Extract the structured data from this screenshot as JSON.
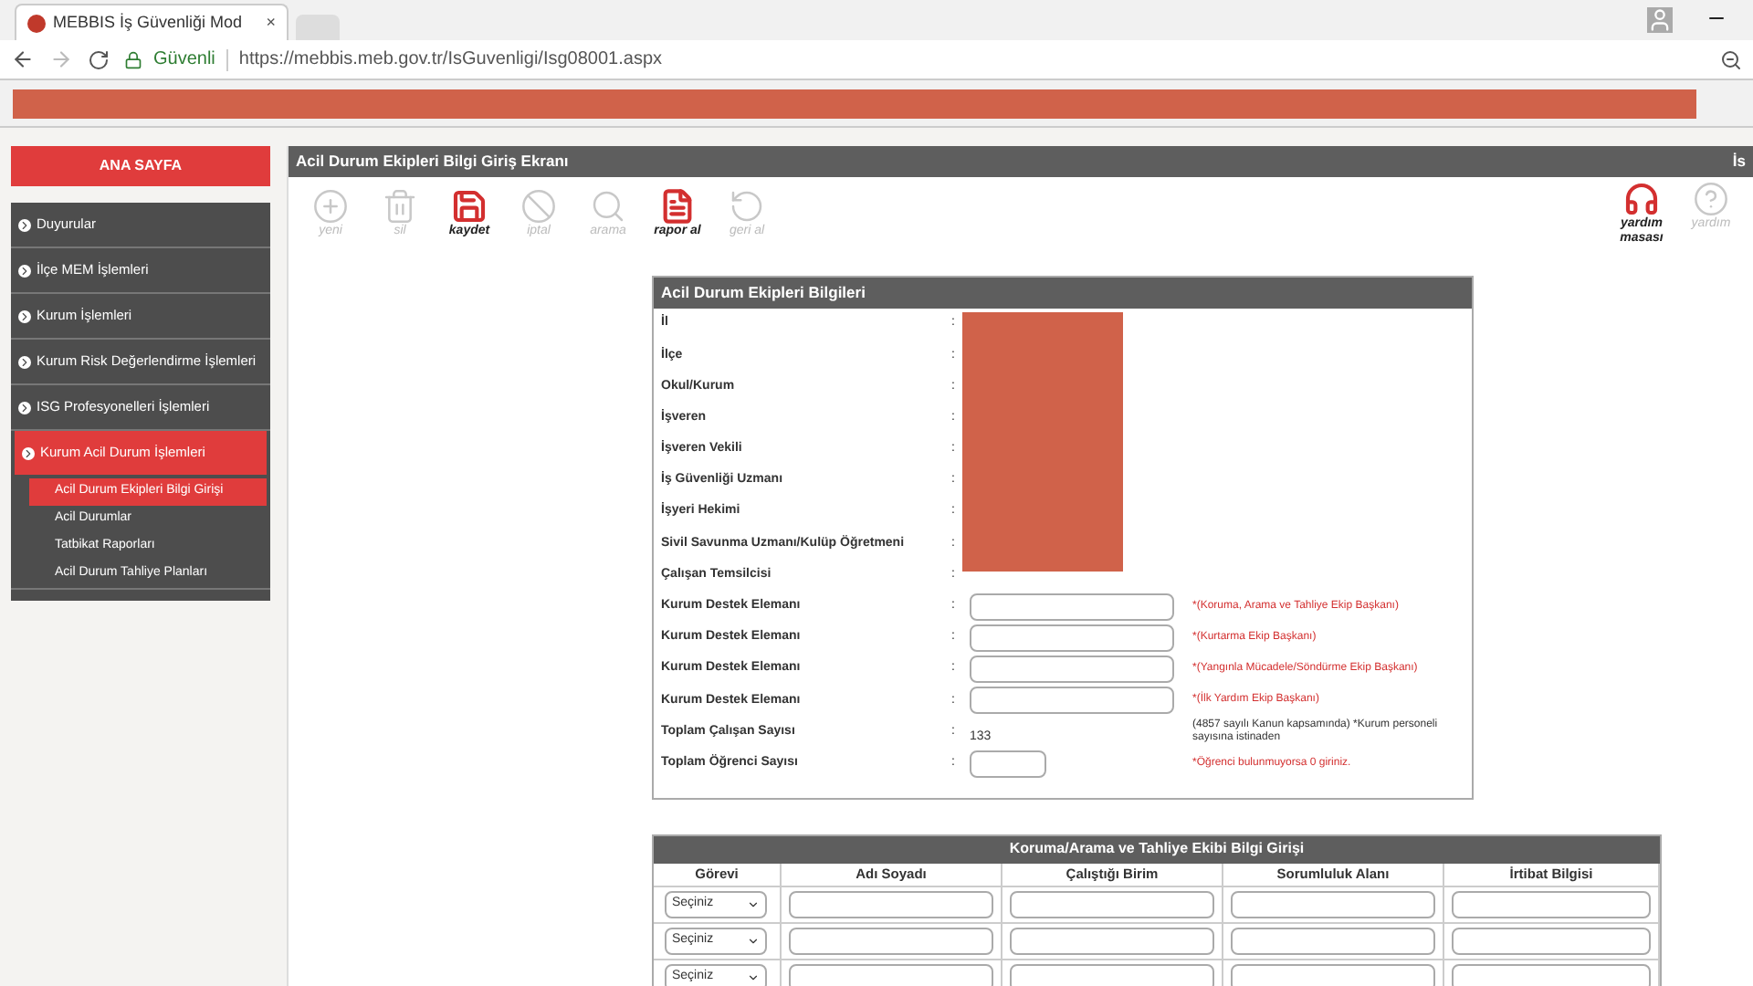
{
  "browser": {
    "tab_title": "MEBBIS İş Güvenliği Mod",
    "tab_close": "×",
    "secure_label": "Güvenli",
    "url": "https://mebbis.meb.gov.tr/IsGuvenligi/Isg08001.aspx"
  },
  "sidebar": {
    "home": "ANA SAYFA",
    "items": [
      {
        "label": "Duyurular",
        "selected": false
      },
      {
        "label": "İlçe MEM İşlemleri",
        "selected": false
      },
      {
        "label": "Kurum İşlemleri",
        "selected": false
      },
      {
        "label": "Kurum Risk Değerlendirme İşlemleri",
        "selected": false
      },
      {
        "label": "ISG Profesyonelleri İşlemleri",
        "selected": false
      },
      {
        "label": "Kurum Acil Durum İşlemleri",
        "selected": true,
        "children": [
          {
            "label": "Acil Durum Ekipleri Bilgi Girişi",
            "selected": true
          },
          {
            "label": "Acil Durumlar",
            "selected": false
          },
          {
            "label": "Tatbikat Raporları",
            "selected": false
          },
          {
            "label": "Acil Durum Tahliye Planları",
            "selected": false
          }
        ]
      }
    ]
  },
  "page": {
    "title": "Acil Durum Ekipleri Bilgi Giriş Ekranı",
    "title_right": "İs"
  },
  "toolbar": [
    {
      "kind": "add",
      "label": "yeni",
      "disabled": true
    },
    {
      "kind": "delete",
      "label": "sil",
      "disabled": true
    },
    {
      "kind": "save",
      "label": "kaydet",
      "disabled": false
    },
    {
      "kind": "cancel",
      "label": "iptal",
      "disabled": true
    },
    {
      "kind": "search",
      "label": "arama",
      "disabled": true
    },
    {
      "kind": "report",
      "label": "rapor al",
      "disabled": false
    },
    {
      "kind": "undo",
      "label": "geri al",
      "disabled": true
    }
  ],
  "toolbar_right": [
    {
      "kind": "support",
      "label": "yardım masası",
      "disabled": false
    },
    {
      "kind": "help",
      "label": "yardım",
      "disabled": true
    }
  ],
  "form": {
    "title": "Acil Durum Ekipleri Bilgileri",
    "info_rows": [
      {
        "label": "İl",
        "separator": ":"
      },
      {
        "label": "İlçe",
        "separator": ":"
      },
      {
        "label": "Okul/Kurum",
        "separator": ":"
      },
      {
        "label": "İşveren",
        "separator": ":"
      },
      {
        "label": "İşveren Vekili",
        "separator": ":"
      },
      {
        "label": "İş Güvenliği Uzmanı",
        "separator": ":"
      },
      {
        "label": "İşyeri Hekimi",
        "separator": ":"
      },
      {
        "label": "Sivil Savunma Uzmanı/Kulüp Öğretmeni",
        "separator": ":"
      },
      {
        "label": "Çalışan Temsilcisi",
        "separator": ":"
      }
    ],
    "input_rows": [
      {
        "kind": "input",
        "label": "Kurum Destek Elemanı",
        "separator": ":",
        "note": "*(Koruma, Arama ve Tahliye Ekip Başkanı)"
      },
      {
        "kind": "input",
        "label": "Kurum Destek Elemanı",
        "separator": ":",
        "note": "*(Kurtarma Ekip Başkanı)"
      },
      {
        "kind": "input",
        "label": "Kurum Destek Elemanı",
        "separator": ":",
        "note": "*(Yangınla Mücadele/Söndürme Ekip Başkanı)"
      },
      {
        "kind": "input",
        "label": "Kurum Destek Elemanı",
        "separator": ":",
        "note": "*(İlk Yardım Ekip Başkanı)"
      },
      {
        "kind": "text",
        "label": "Toplam Çalışan Sayısı",
        "separator": ":",
        "value": "133",
        "note": "(4857 sayılı Kanun kapsamında) *Kurum personeli sayısına istinaden"
      },
      {
        "kind": "small_input",
        "label": "Toplam Öğrenci Sayısı",
        "separator": ":",
        "note": "*Öğrenci bulunmuyorsa 0 giriniz."
      }
    ]
  },
  "team_table": {
    "title": "Koruma/Arama ve Tahliye Ekibi Bilgi Girişi",
    "columns": [
      "Görevi",
      "Adı Soyadı",
      "Çalıştığı Birim",
      "Sorumluluk Alanı",
      "İrtibat Bilgisi"
    ],
    "rows": [
      {
        "role": "Seçiniz"
      },
      {
        "role": "Seçiniz"
      },
      {
        "role": "Seçiniz"
      }
    ]
  }
}
